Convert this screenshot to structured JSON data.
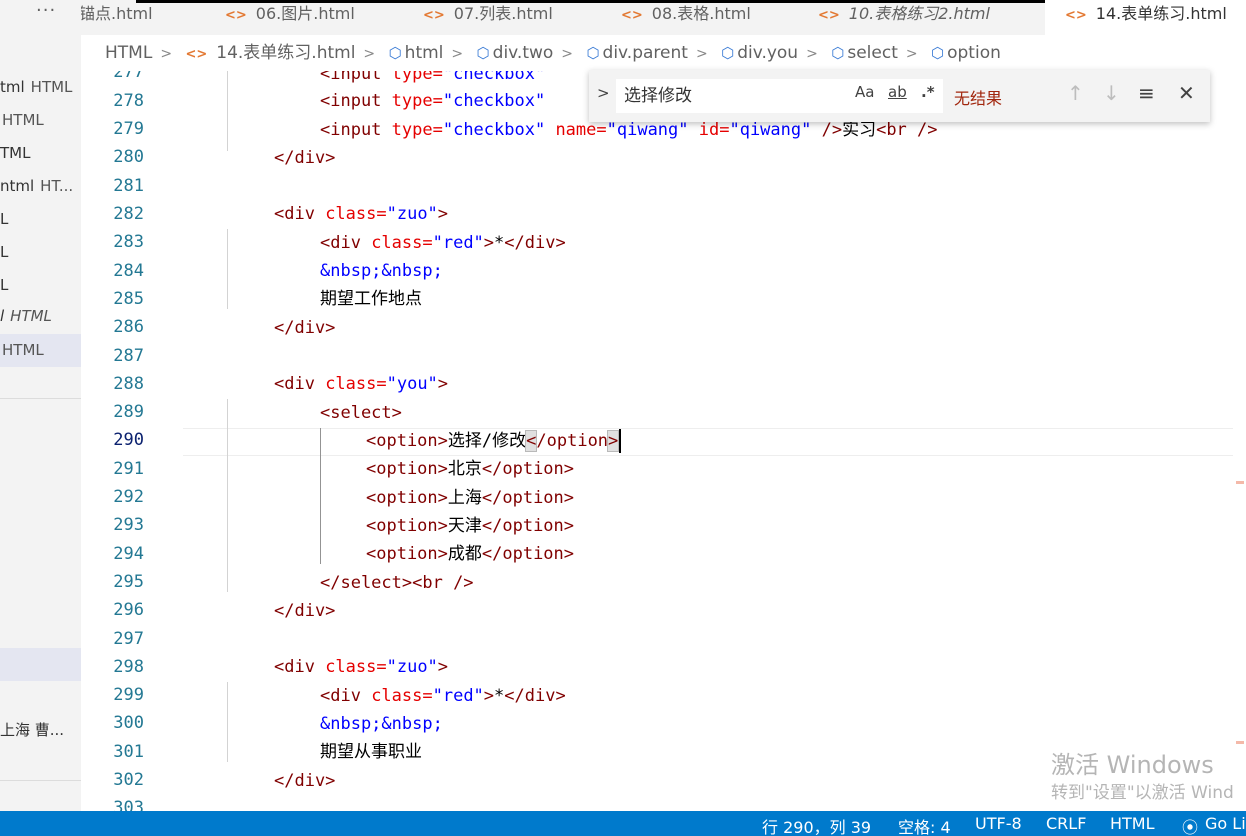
{
  "sidebar": {
    "more_label": "···",
    "items": [
      {
        "name": "tml",
        "type": "HTML"
      },
      {
        "name": "",
        "type": "HTML"
      },
      {
        "name": "TML",
        "type": ""
      },
      {
        "name": "ntml",
        "type": "HT..."
      },
      {
        "name": "L",
        "type": ""
      },
      {
        "name": "L",
        "type": ""
      },
      {
        "name": "L",
        "type": ""
      },
      {
        "name": "l",
        "type": "HTML"
      },
      {
        "name": "",
        "type": "HTML"
      }
    ],
    "bottom_item": "上海 曹..."
  },
  "tabs": [
    {
      "label": "锚点.html"
    },
    {
      "label": "06.图片.html"
    },
    {
      "label": "07.列表.html"
    },
    {
      "label": "08.表格.html"
    },
    {
      "label": "10.表格练习2.html"
    },
    {
      "label": "14.表单练习.html"
    }
  ],
  "breadcrumb": [
    "HTML",
    "14.表单练习.html",
    "html",
    "div.two",
    "div.parent",
    "div.you",
    "select",
    "option"
  ],
  "find": {
    "query": "选择修改",
    "match_case": "Aa",
    "whole_word": "ab",
    "regex": ".*",
    "result": "无结果"
  },
  "editor": {
    "line_numbers": [
      "277",
      "278",
      "279",
      "280",
      "281",
      "282",
      "283",
      "284",
      "285",
      "286",
      "287",
      "288",
      "289",
      "290",
      "291",
      "292",
      "293",
      "294",
      "295",
      "296",
      "297",
      "298",
      "299",
      "300",
      "301",
      "302",
      "303"
    ],
    "current_line": "290",
    "lines": {
      "l277": {
        "tag": "<input",
        "attr": " type=",
        "val": "\"checkbox\""
      },
      "l278": {
        "tag": "<input",
        "attr": " type=",
        "val": "\"checkbox\""
      },
      "l279": {
        "tag": "<input",
        "attr1": " type=",
        "val1": "\"checkbox\"",
        "attr2": " name=",
        "val2": "\"qiwang\"",
        "attr3": " id=",
        "val3": "\"qiwang\"",
        "close": " />",
        "text": "实习",
        "br": "<br />"
      },
      "l280": "</div>",
      "l282": {
        "tag": "<div",
        "attr": " class=",
        "val": "\"zuo\"",
        "close": ">"
      },
      "l283": {
        "tag": "<div",
        "attr": " class=",
        "val": "\"red\"",
        "close": ">",
        "text": "*",
        "end": "</div>"
      },
      "l284": "&nbsp;&nbsp;",
      "l285": "期望工作地点",
      "l286": "</div>",
      "l288": {
        "tag": "<div",
        "attr": " class=",
        "val": "\"you\"",
        "close": ">"
      },
      "l289": "<select>",
      "l290": {
        "open": "<option>",
        "text": "选择/修改",
        "lt": "<",
        "end": "/option",
        "gt": ">"
      },
      "l291": {
        "open": "<option>",
        "text": "北京",
        "end": "</option>"
      },
      "l292": {
        "open": "<option>",
        "text": "上海",
        "end": "</option>"
      },
      "l293": {
        "open": "<option>",
        "text": "天津",
        "end": "</option>"
      },
      "l294": {
        "open": "<option>",
        "text": "成都",
        "end": "</option>"
      },
      "l295": {
        "end": "</select>",
        "br": "<br />"
      },
      "l296": "</div>",
      "l298": {
        "tag": "<div",
        "attr": " class=",
        "val": "\"zuo\"",
        "close": ">"
      },
      "l299": {
        "tag": "<div",
        "attr": " class=",
        "val": "\"red\"",
        "close": ">",
        "text": "*",
        "end": "</div>"
      },
      "l300": "&nbsp;&nbsp;",
      "l301": "期望从事职业",
      "l302": "</div>"
    }
  },
  "watermark": {
    "line1": "激活 Windows",
    "line2": "转到\"设置\"以激活 Wind"
  },
  "status": {
    "position": "行 290，列 39",
    "spaces": "空格: 4",
    "encoding": "UTF-8",
    "eol": "CRLF",
    "language": "HTML",
    "golive": "Go Li"
  },
  "colors": {
    "status_bar": "#007acc",
    "tag": "#800000",
    "attribute": "#e50000",
    "value": "#0000ff",
    "line_number": "#237893"
  }
}
